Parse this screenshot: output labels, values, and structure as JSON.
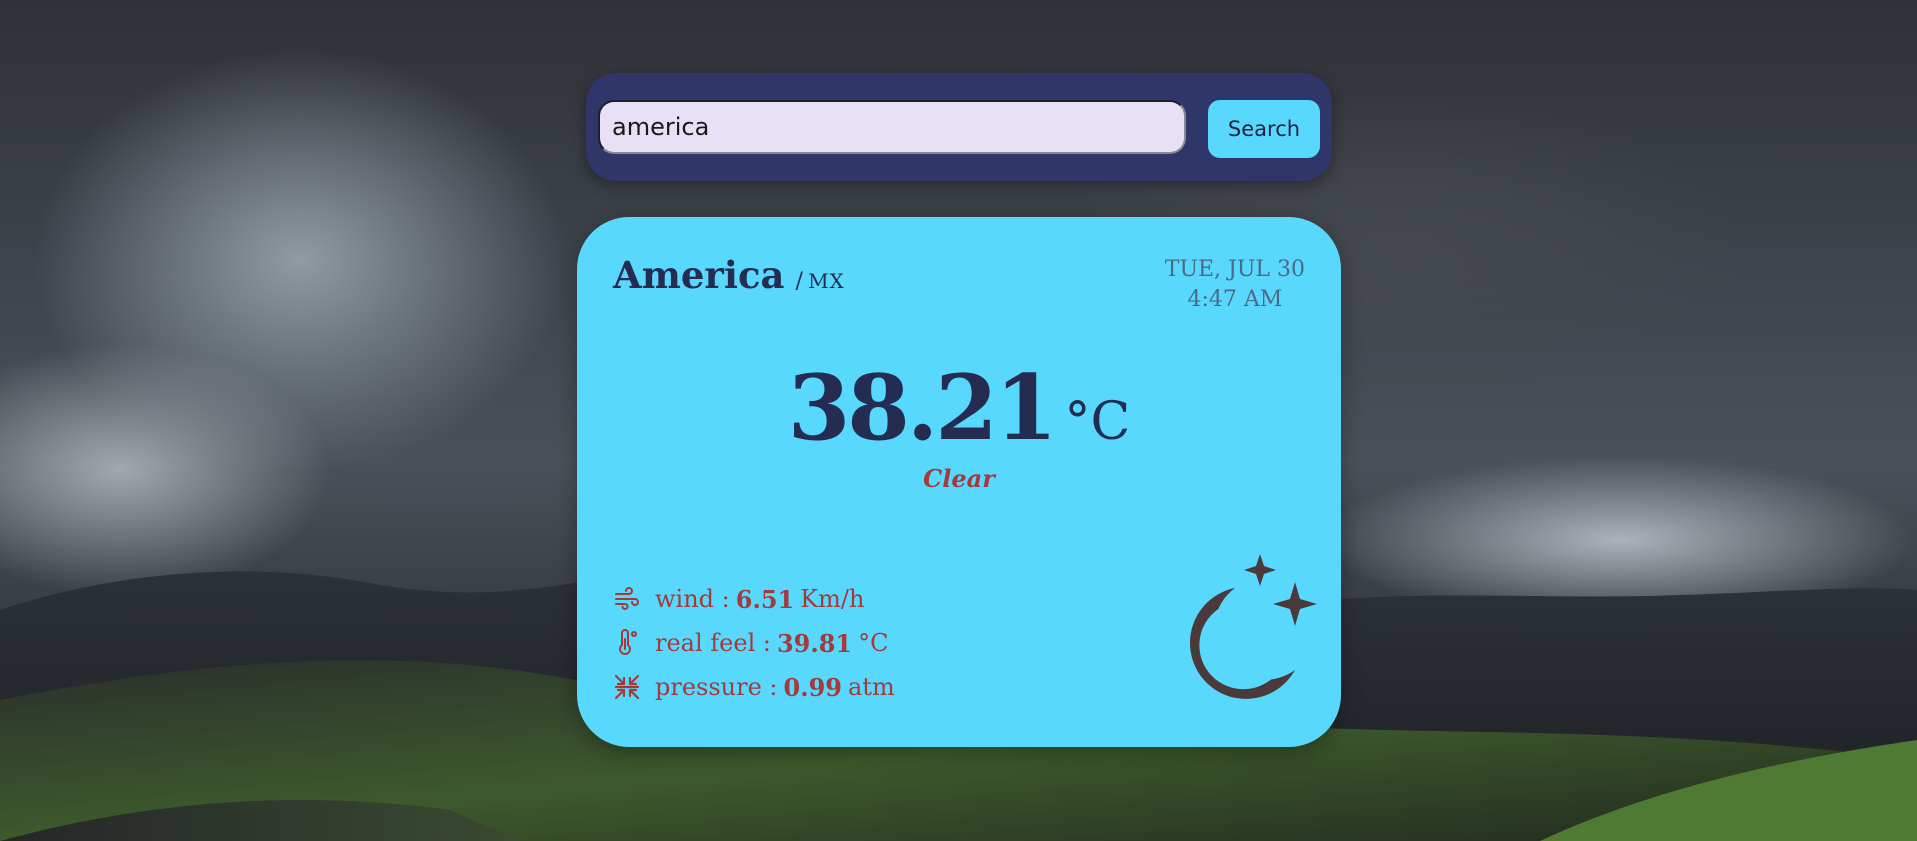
{
  "search": {
    "value": "america",
    "button_label": "Search"
  },
  "weather": {
    "city": "America",
    "separator": "/",
    "country": "MX",
    "date": "TUE, JUL 30",
    "time": "4:47 AM",
    "temperature": "38.21",
    "unit": "°C",
    "condition": "Clear",
    "condition_icon": "moon-stars-icon"
  },
  "stats": {
    "wind": {
      "label": "wind :",
      "value": "6.51",
      "unit": "Km/h",
      "icon": "wind-icon"
    },
    "real_feel": {
      "label": "real feel :",
      "value": "39.81",
      "unit": "°C",
      "icon": "thermometer-icon"
    },
    "pressure": {
      "label": "pressure :",
      "value": "0.99",
      "unit": "atm",
      "icon": "pressure-icon"
    }
  },
  "colors": {
    "card": "#58d8fd",
    "search_bar": "#2f3669",
    "primary_text": "#252c52",
    "accent_text": "#a43a3c",
    "icon": "#4a3a3c"
  }
}
